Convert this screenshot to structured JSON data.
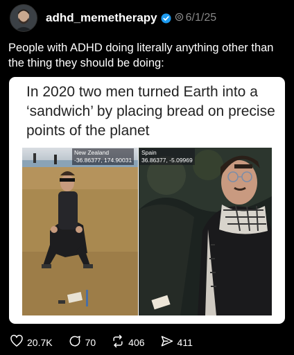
{
  "post": {
    "username": "adhd_memetherapy",
    "date": "6/1/25",
    "caption": "People with ADHD doing literally anything other than the thing they should be doing:"
  },
  "card": {
    "title": "In 2020 two men turned Earth into a ‘sandwich’ by placing bread on precise points of the planet",
    "left_photo": {
      "location": "New Zealand",
      "coords": "-36.86377, 174.90031"
    },
    "right_photo": {
      "location": "Spain",
      "coords": "36.86377, -5.09969"
    }
  },
  "actions": {
    "likes": "20.7K",
    "replies": "70",
    "reposts": "406",
    "shares": "411"
  },
  "colors": {
    "verified_badge": "#1d9bf0",
    "muted": "#888888"
  },
  "icons": [
    "verified-badge-icon",
    "threads-icon",
    "heart-icon",
    "reply-icon",
    "repost-icon",
    "share-icon"
  ]
}
